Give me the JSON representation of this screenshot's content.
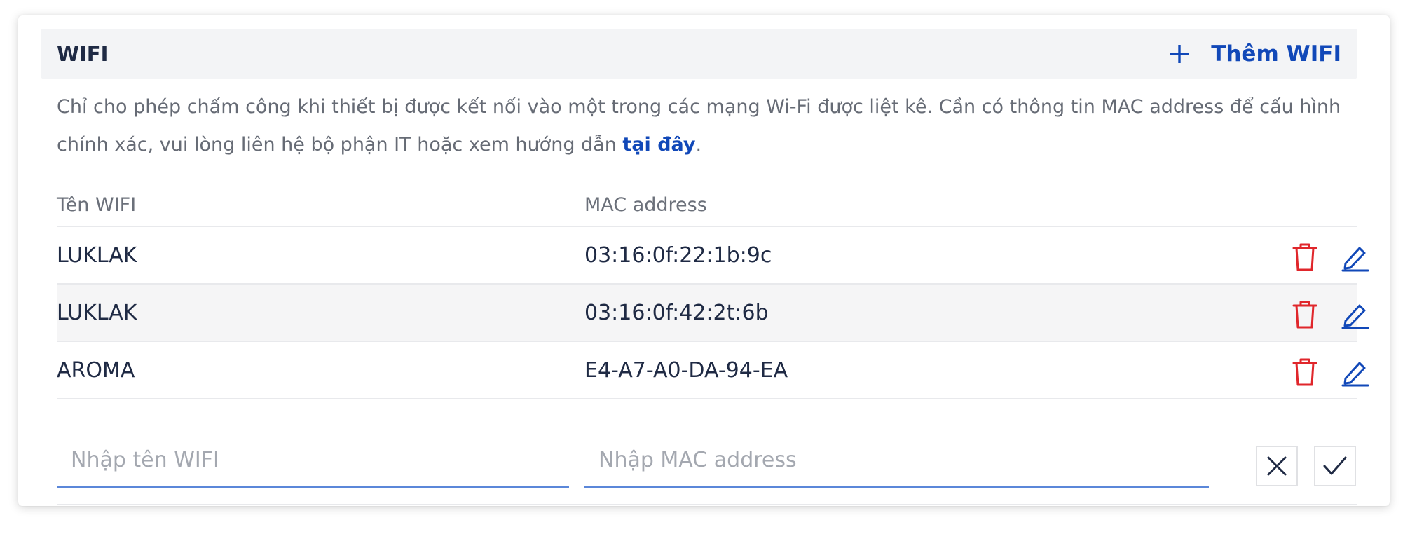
{
  "section": {
    "title": "WIFI",
    "add_label": "Thêm WIFI",
    "description_text": "Chỉ cho phép chấm công khi thiết bị được kết nối vào một trong các mạng Wi-Fi được liệt kê. Cần có thông tin MAC address để cấu hình chính xác, vui lòng liên hệ bộ phận IT hoặc xem hướng dẫn ",
    "description_link": "tại đây",
    "description_end": "."
  },
  "table": {
    "columns": [
      "Tên WIFI",
      "MAC address"
    ],
    "rows": [
      {
        "name": "LUKLAK",
        "mac": "03:16:0f:22:1b:9c"
      },
      {
        "name": "LUKLAK",
        "mac": "03:16:0f:42:2t:6b"
      },
      {
        "name": "AROMA",
        "mac": "E4-A7-A0-DA-94-EA"
      }
    ]
  },
  "new_entry": {
    "name_placeholder": "Nhập tên WIFI",
    "mac_placeholder": "Nhập MAC address",
    "name_value": "",
    "mac_value": ""
  },
  "icons": {
    "add": "plus-icon",
    "delete": "trash-icon",
    "edit": "pencil-icon",
    "cancel": "close-icon",
    "confirm": "check-icon"
  },
  "colors": {
    "accent": "#1148b8",
    "danger": "#e0262b",
    "input_underline": "#5b87d9",
    "header_bg": "#f3f4f6",
    "row_alt_bg": "#f5f5f6"
  }
}
